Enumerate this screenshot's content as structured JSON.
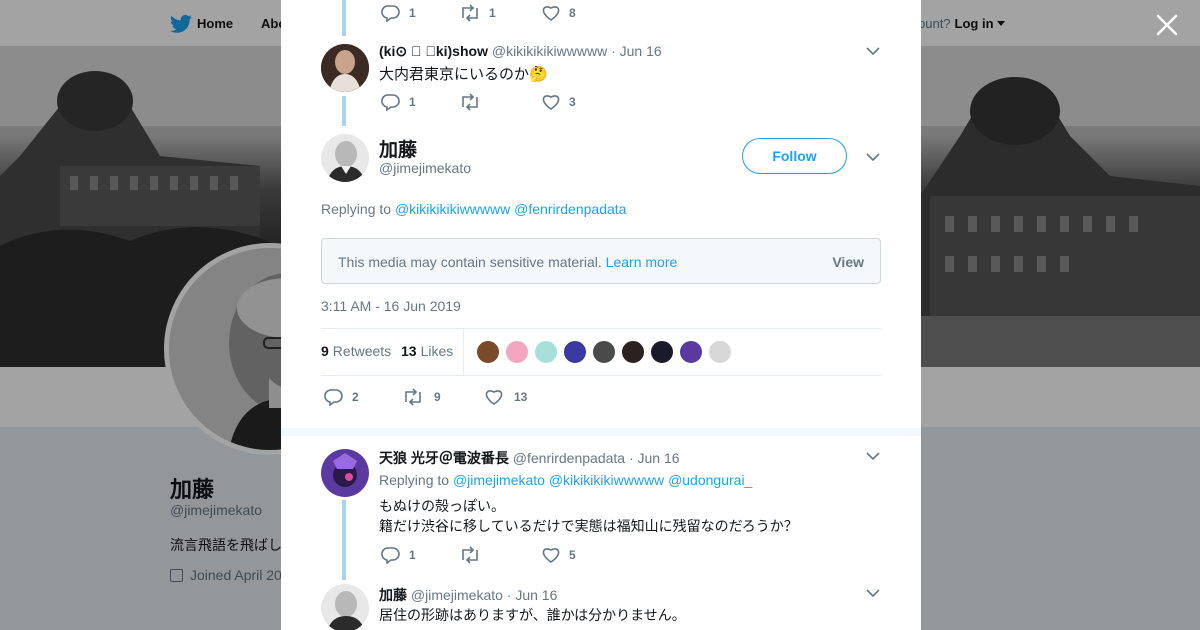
{
  "page": {
    "nav": {
      "home_label": "Home",
      "about_label": "Abo",
      "account_prompt": "ccount?",
      "login_label": "Log in"
    },
    "profile": {
      "name": "加藤",
      "handle": "@jimejimekato",
      "bio": "流言飛語を飛ばし",
      "joined": "Joined April 20"
    }
  },
  "modal": {
    "top_tweet_actions": {
      "replies": "1",
      "retweets": "1",
      "likes": "8"
    },
    "reply_1": {
      "name": "(ki⊙ ⃞ ⃞ki)show",
      "handle": "@kikikikikiwwwww",
      "date": "· Jun 16",
      "text": "大内君東京にいるのか🤔",
      "replies": "1",
      "retweets": "",
      "likes": "3"
    },
    "main_tweet": {
      "name": "加藤",
      "handle": "@jimejimekato",
      "follow_label": "Follow",
      "replying_to_label": "Replying to",
      "replying_to": [
        "@kikikikikiwwwww",
        "@fenrirdenpadata"
      ],
      "sensitive_text": "This media may contain sensitive material.",
      "learn_more": "Learn more",
      "view_label": "View",
      "timestamp": "3:11 AM - 16 Jun 2019",
      "retweets_count": "9",
      "retweets_label": "Retweets",
      "likes_count": "13",
      "likes_label": "Likes",
      "replies": "2",
      "retweets": "9",
      "likes": "13"
    },
    "reply_2": {
      "name": "天狼 光牙＠電波番長",
      "handle": "@fenrirdenpadata",
      "date": "· Jun 16",
      "replying_to_label": "Replying to",
      "replying_to": [
        "@jimejimekato",
        "@kikikikikiwwwww",
        "@udongurai_"
      ],
      "text_line1": "もぬけの殻っぽい。",
      "text_line2": "籍だけ渋谷に移しているだけで実態は福知山に残留なのだろうか？",
      "replies": "1",
      "retweets": "",
      "likes": "5"
    },
    "reply_3": {
      "name": "加藤",
      "handle": "@jimejimekato",
      "date": "· Jun 16",
      "text": "居住の形跡はありますが、誰かは分かりません。"
    }
  },
  "colors": {
    "accent": "#1da1f2",
    "muted": "#657786",
    "thread": "#a8d4f0",
    "text": "#14171a"
  },
  "icons": [
    "twitter-bird-icon",
    "close-icon",
    "chevron-down-icon",
    "reply-icon",
    "retweet-icon",
    "like-icon",
    "calendar-icon"
  ]
}
